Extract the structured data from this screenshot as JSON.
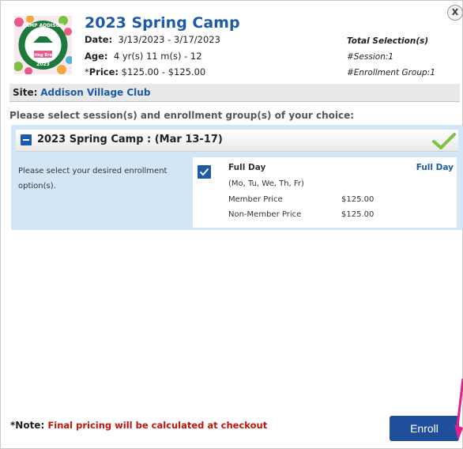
{
  "close": {
    "label": "X"
  },
  "logo": {
    "ring_text": "CAMP ADDISON",
    "line1": "Spring Break",
    "line2": "2023"
  },
  "camp": {
    "title": "2023 Spring Camp",
    "date_label": "Date:",
    "date_value": "3/13/2023 - 3/17/2023",
    "age_label": "Age:",
    "age_value": "4 yr(s) 11 m(s) - 12",
    "price_star": "*",
    "price_label": "Price:",
    "price_value": "$125.00 - $125.00"
  },
  "selection": {
    "heading": "Total Selection(s)",
    "session": "#Session:1",
    "group": "#Enrollment Group:1"
  },
  "site": {
    "label": "Site:",
    "value": "Addison Village Club"
  },
  "instruction": "Please select session(s) and enrollment group(s) of your choice:",
  "session": {
    "title": "2023 Spring Camp : (Mar 13-17)",
    "prompt": "Please select your desired enrollment option(s).",
    "option": {
      "name": "Full Day",
      "group": "Full Day",
      "days": "(Mo, Tu, We, Th, Fr)",
      "checked": true,
      "prices": [
        {
          "label": "Member Price",
          "value": "$125.00"
        },
        {
          "label": "Non-Member Price",
          "value": "$125.00"
        }
      ]
    }
  },
  "note": {
    "label": "*Note:",
    "text": "Final pricing will be calculated at checkout"
  },
  "enroll_button": "Enroll",
  "colors": {
    "brand": "#1d5aa8",
    "button": "#1f4f9c",
    "panel": "#d2e6f6",
    "check": "#7cc142",
    "note_red": "#c0140c",
    "arrow": "#e1218b"
  }
}
